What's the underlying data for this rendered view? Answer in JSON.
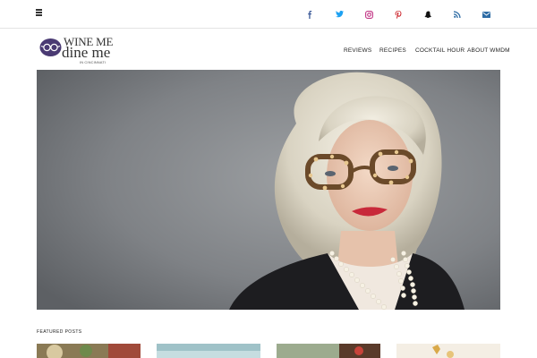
{
  "topbar": {
    "menu_icon": "hamburger-icon",
    "social": [
      {
        "name": "facebook-icon",
        "color": "#3b5998"
      },
      {
        "name": "twitter-icon",
        "color": "#1da1f2"
      },
      {
        "name": "instagram-icon",
        "color": "#c13584"
      },
      {
        "name": "pinterest-icon",
        "color": "#cb2027"
      },
      {
        "name": "snapchat-icon",
        "color": "#111111"
      },
      {
        "name": "rss-icon",
        "color": "#2e6ca5"
      },
      {
        "name": "email-icon",
        "color": "#2e6ca5"
      }
    ]
  },
  "logo": {
    "line1": "WINE ME",
    "line2": "dine me",
    "line3": "IN CINCINNATI",
    "mark_color": "#4a3a73"
  },
  "nav": {
    "items": [
      "REVIEWS",
      "RECIPES",
      "COCKTAIL HOUR",
      "ABOUT WMDM"
    ]
  },
  "hero": {
    "image": "portrait-photo"
  },
  "featured": {
    "label": "FEATURED POSTS",
    "thumbs": [
      "featured-post-1",
      "featured-post-2",
      "featured-post-3",
      "featured-post-4"
    ]
  }
}
